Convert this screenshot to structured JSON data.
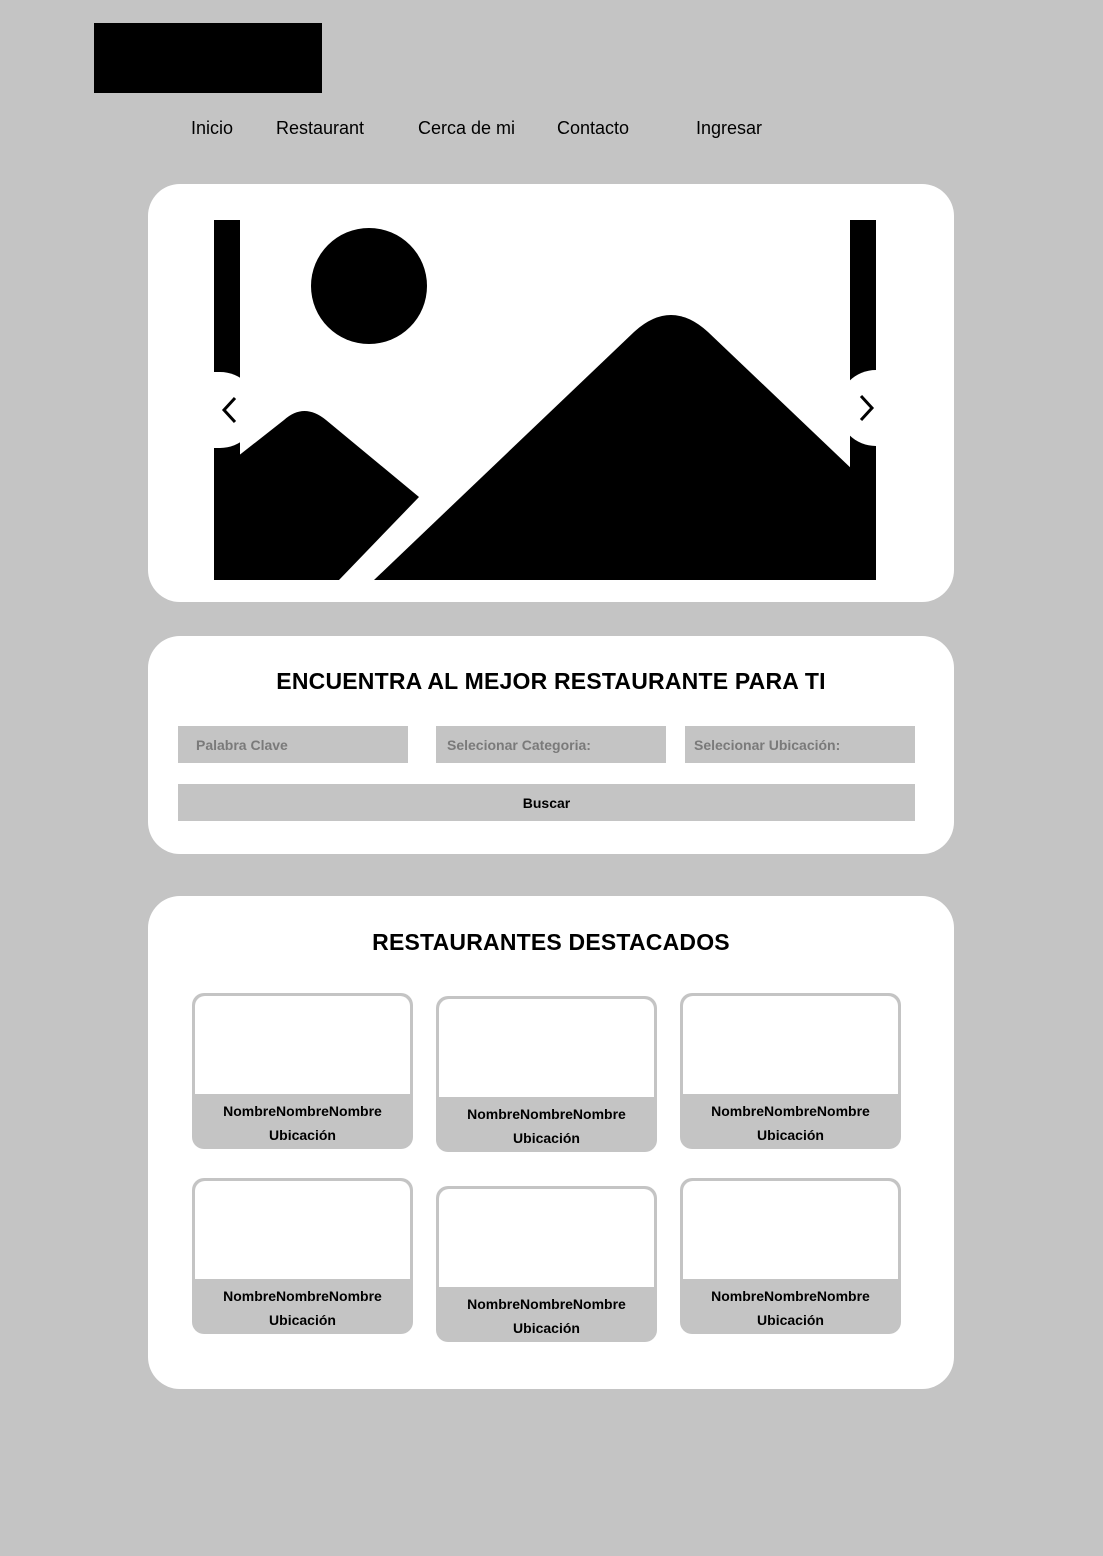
{
  "header": {
    "logo": "logo",
    "nav": [
      {
        "label": "Inicio"
      },
      {
        "label": "Restaurant"
      },
      {
        "label": "Cerca de mi"
      },
      {
        "label": "Contacto"
      },
      {
        "label": "Ingresar"
      }
    ]
  },
  "hero": {
    "image_icon": "image-placeholder-icon",
    "prev_icon": "chevron-left-icon",
    "next_icon": "chevron-right-icon"
  },
  "search": {
    "title": "ENCUENTRA AL MEJOR RESTAURANTE PARA TI",
    "keyword_placeholder": "Palabra Clave",
    "category_placeholder": "Selecionar Categoria:",
    "location_placeholder": "Selecionar Ubicación:",
    "button_label": "Buscar"
  },
  "featured": {
    "title": "RESTAURANTES DESTACADOS",
    "cards": [
      {
        "name": "NombreNombreNombre",
        "location": "Ubicación"
      },
      {
        "name": "NombreNombreNombre",
        "location": "Ubicación"
      },
      {
        "name": "NombreNombreNombre",
        "location": "Ubicación"
      },
      {
        "name": "NombreNombreNombre",
        "location": "Ubicación"
      },
      {
        "name": "NombreNombreNombre",
        "location": "Ubicación"
      },
      {
        "name": "NombreNombreNombre",
        "location": "Ubicación"
      }
    ]
  },
  "colors": {
    "background": "#c4c4c4",
    "panel": "#ffffff",
    "text": "#000000",
    "placeholder_text": "#7a7a7a"
  }
}
